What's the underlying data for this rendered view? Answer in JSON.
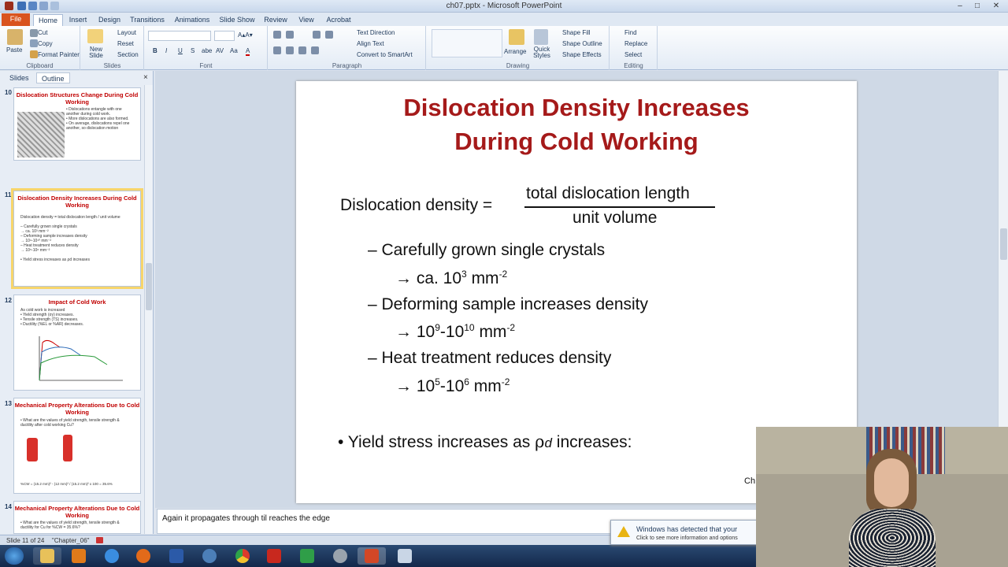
{
  "window": {
    "title": "ch07.pptx - Microsoft PowerPoint"
  },
  "tabs": [
    "File",
    "Home",
    "Insert",
    "Design",
    "Transitions",
    "Animations",
    "Slide Show",
    "Review",
    "View",
    "Acrobat"
  ],
  "ribbon": {
    "clipboard": {
      "paste": "Paste",
      "cut": "Cut",
      "copy": "Copy",
      "format_painter": "Format Painter",
      "label": "Clipboard"
    },
    "slides": {
      "new_slide": "New Slide",
      "layout": "Layout",
      "reset": "Reset",
      "section": "Section",
      "label": "Slides"
    },
    "font": {
      "label": "Font",
      "bold": "B",
      "italic": "I",
      "underline": "U",
      "strike": "S",
      "shadow": "abe",
      "spacing": "AV",
      "case": "Aa",
      "color": "A"
    },
    "paragraph": {
      "label": "Paragraph",
      "text_direction": "Text Direction",
      "align_text": "Align Text",
      "smartart": "Convert to SmartArt"
    },
    "drawing": {
      "label": "Drawing",
      "arrange": "Arrange",
      "quick_styles": "Quick Styles",
      "shape_fill": "Shape Fill",
      "shape_outline": "Shape Outline",
      "shape_effects": "Shape Effects"
    },
    "editing": {
      "label": "Editing",
      "find": "Find",
      "replace": "Replace",
      "select": "Select"
    }
  },
  "left_pane": {
    "tabs": [
      "Slides",
      "Outline"
    ],
    "close": "×",
    "slides": [
      {
        "num": "10",
        "title": "Dislocation Structures Change During Cold Working",
        "lines": [
          "• Dislocation structure in Ti after cold working.",
          "• Dislocations entangle with one",
          "  another during cold work.",
          "• More dislocations are also formed.",
          "• On average, dislocations repel one",
          "  another, so dislocation motion",
          "  becomes more difficult."
        ]
      },
      {
        "num": "11",
        "title": "Dislocation Density Increases During Cold Working",
        "lines": [
          "Dislocation density = total dislocation length / unit volume",
          "– Carefully grown single crystals",
          "   → ca. 10³ mm⁻²",
          "– Deforming sample increases density",
          "   → 10⁹-10¹⁰ mm⁻²",
          "– Heat treatment reduces density",
          "   → 10⁵-10⁶ mm⁻²",
          "• Yield stress increases as ρd increases"
        ]
      },
      {
        "num": "12",
        "title": "Impact of Cold Work",
        "lines": [
          "As cold work is increased",
          "• Yield strength (σy) increases.",
          "• Tensile strength (TS) increases.",
          "• Ductility (%EL or %AR) decreases."
        ]
      },
      {
        "num": "13",
        "title": "Mechanical Property Alterations Due to Cold Working",
        "lines": [
          "• What are the values of yield strength, tensile strength &",
          "  ductility after cold working Cu?",
          "%CW = (15.2 mm)² - (12 mm)² / (15.2 mm)² x 100 = 35.6%"
        ]
      },
      {
        "num": "14",
        "title": "Mechanical Property Alterations Due to Cold Working",
        "lines": [
          "• What are the values of yield strength, tensile strength &",
          "  ductility for Cu for %CW = 35.6%?"
        ]
      }
    ]
  },
  "slide": {
    "title_line1": "Dislocation Density Increases",
    "title_line2": "During Cold Working",
    "equation_lhs": "Dislocation density  =",
    "numerator": "total dislocation length",
    "denominator": "unit volume",
    "bullet1": "– Carefully grown single crystals",
    "bullet1_sub_prefix": "→ ca. 10",
    "bullet1_sub_exp": "3",
    "bullet1_sub_unit": " mm",
    "bullet1_sub_unit_exp": "-2",
    "bullet2": "– Deforming sample increases density",
    "bullet2_sub_a": "→ 10",
    "bullet2_sub_a_exp": "9",
    "bullet2_sub_b": "-10",
    "bullet2_sub_b_exp": "10",
    "bullet2_sub_unit": " mm",
    "bullet2_sub_unit_exp": "-2",
    "bullet3": "– Heat treatment reduces density",
    "bullet3_sub_a": "→ 10",
    "bullet3_sub_a_exp": "5",
    "bullet3_sub_b": "-10",
    "bullet3_sub_b_exp": "6",
    "bullet3_sub_unit": " mm",
    "bullet3_sub_unit_exp": "-2",
    "yield_pre": "• Yield stress increases as ",
    "yield_rho": "ρ",
    "yield_d": "d",
    "yield_post": " increases:",
    "corner_text": "Ch"
  },
  "notes": {
    "text": "Again it propagates through til reaches the edge"
  },
  "status_bar": {
    "slide_info": "Slide 11 of 24",
    "theme": "\"Chapter_06\""
  },
  "notification": {
    "line1": "Windows has detected that your",
    "line2": "Click to see more information and options"
  },
  "colors": {
    "title_red": "#a51a1a",
    "file_tab": "#d9531e",
    "selected_thumb": "#f7d56b",
    "taskbar": "#1e3a61"
  }
}
